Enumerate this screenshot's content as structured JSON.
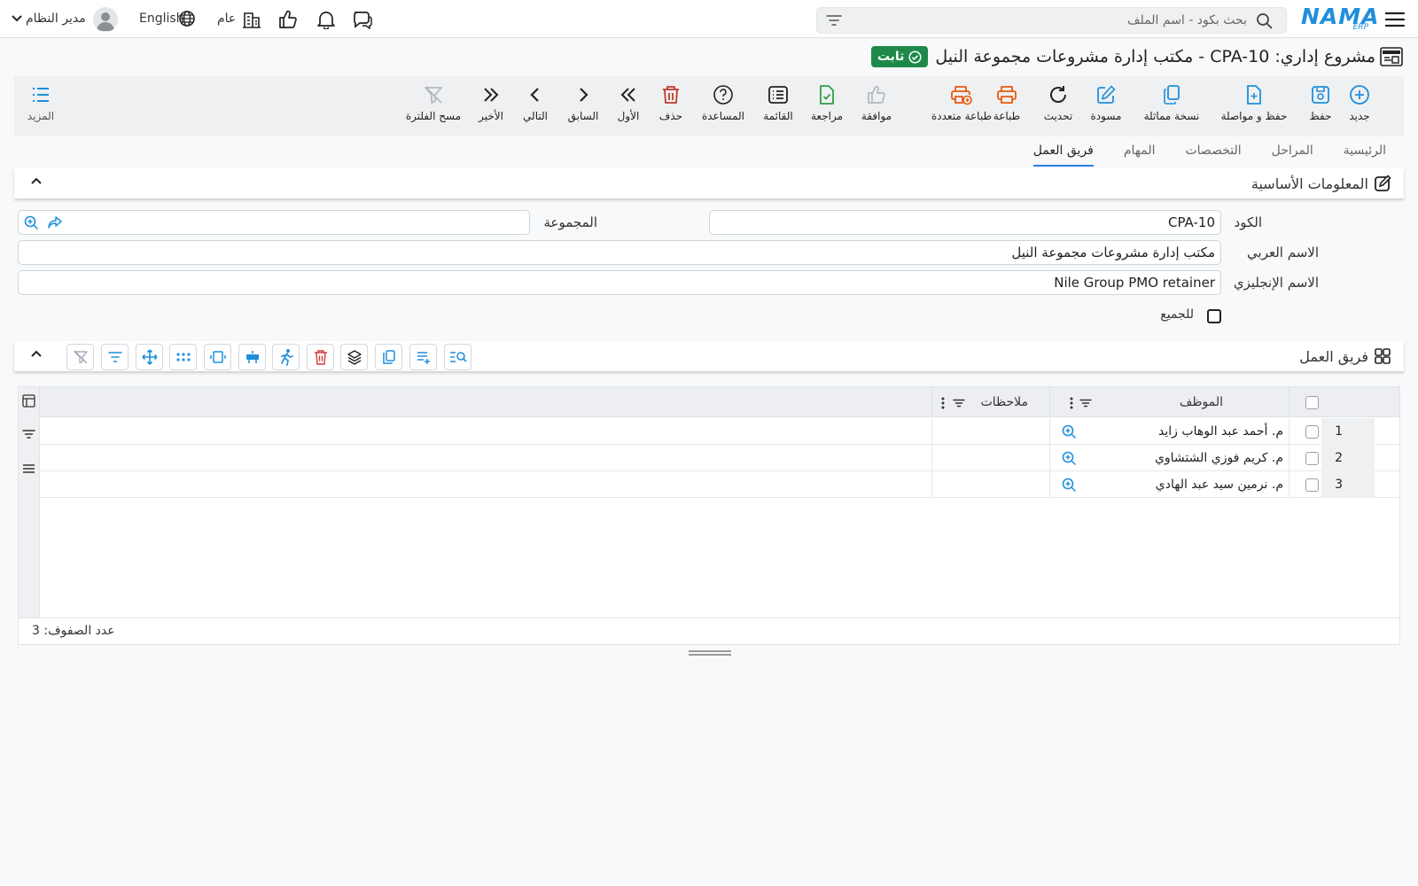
{
  "topbar": {
    "search_placeholder": "بحث بكود - اسم الملف",
    "logo_text": "NAMA",
    "logo_sub": "ERP",
    "branch_label": "عام",
    "language_label": "English",
    "user_label": "مدير النظام"
  },
  "page": {
    "title": "مشروع إداري: CPA-10 - مكتب إدارة مشروعات مجموعة النيل",
    "status": "ثابت",
    "status_color": "#1e8a4a"
  },
  "toolbar": {
    "new": "جديد",
    "save": "حفظ",
    "save_continue": "حفظ و مواصلة",
    "similar_copy": "نسخة مماثلة",
    "draft": "مسودة",
    "refresh": "تحديث",
    "print": "طباعة",
    "multi_print": "طباعة متعددة",
    "approve": "موافقة",
    "review": "مراجعة",
    "list": "القائمة",
    "help": "المساعدة",
    "delete": "حذف",
    "first": "الأول",
    "previous": "السابق",
    "next": "التالي",
    "last": "الأخير",
    "clear_filter": "مسح الفلترة",
    "more": "المزيد"
  },
  "tabs": [
    "الرئيسية",
    "المراحل",
    "التخصصات",
    "المهام",
    "فريق العمل"
  ],
  "basic_info": {
    "title": "المعلومات الأساسية",
    "code_label": "الكود",
    "code_value": "CPA-10",
    "group_label": "المجموعة",
    "group_value": "",
    "arabic_name_label": "الاسم العربي",
    "arabic_name_value": "مكتب إدارة مشروعات مجموعة النيل",
    "english_name_label": "الاسم الإنجليزي",
    "english_name_value": "Nile Group PMO retainer",
    "for_all_label": "للجميع"
  },
  "team": {
    "title": "فريق العمل",
    "columns": {
      "employee": "الموظف",
      "notes": "ملاحظات"
    },
    "rows": [
      {
        "num": "1",
        "employee": "م. أحمد عبد الوهاب زايد",
        "notes": ""
      },
      {
        "num": "2",
        "employee": "م. كريم فوزي الشتشاوي",
        "notes": ""
      },
      {
        "num": "3",
        "employee": "م. نرمين سيد عبد الهادي",
        "notes": ""
      }
    ],
    "row_count": "عدد الصفوف: 3"
  },
  "colors": {
    "accent": "#2c7be5",
    "toolbar_icon": "#1f8fdc",
    "delete": "#c0392b",
    "print": "#e8590c"
  }
}
